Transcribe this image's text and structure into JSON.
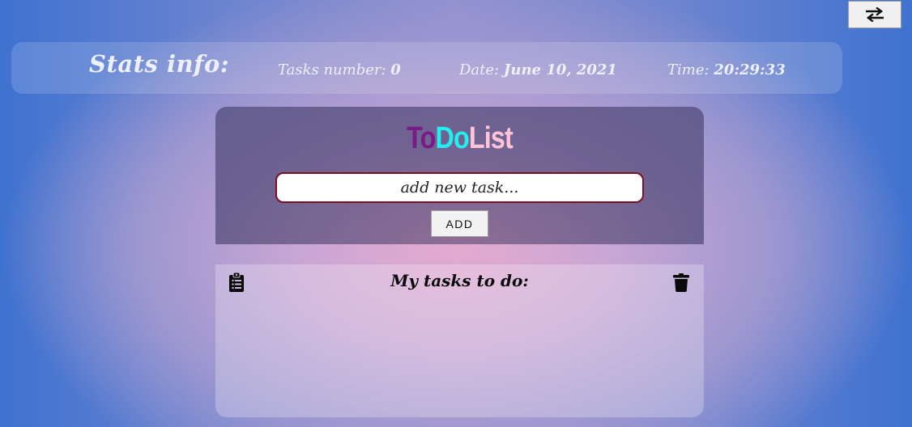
{
  "toolbar": {
    "swap_icon": "swap-arrows-icon"
  },
  "stats": {
    "title": "Stats info:",
    "tasks_label": "Tasks number:",
    "tasks_value": "0",
    "date_label": "Date:",
    "date_value": "June 10, 2021",
    "time_label": "Time:",
    "time_value": "20:29:33"
  },
  "app": {
    "title_part1": "To",
    "title_part2": "Do",
    "title_part3": "List",
    "title_colors": [
      "#7a1a86",
      "#22f0ee",
      "#ffc4d9"
    ],
    "input_placeholder": "add new task...",
    "add_button_label": "ADD"
  },
  "tasks": {
    "title": "My tasks to do:",
    "left_icon": "clipboard-list-icon",
    "right_icon": "trash-icon",
    "items": []
  }
}
